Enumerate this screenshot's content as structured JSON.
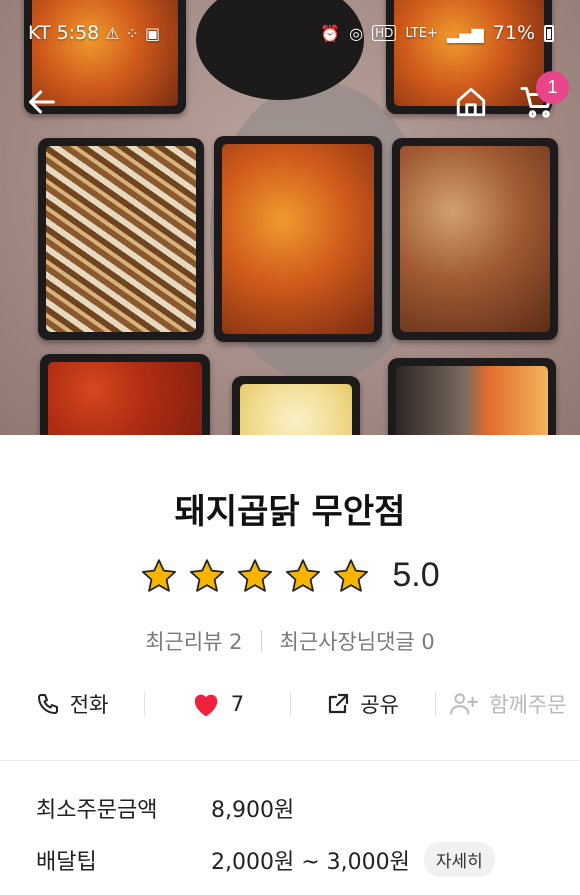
{
  "status_bar": {
    "carrier": "KT",
    "time": "5:58",
    "network": "LTE+",
    "battery": "71%"
  },
  "nav": {
    "cart_count": "1"
  },
  "store": {
    "name": "돼지곱닭 무안점",
    "rating": "5.0",
    "star_count": 5,
    "recent_reviews": "최근리뷰 2",
    "owner_comments": "최근사장님댓글 0"
  },
  "actions": {
    "call": "전화",
    "likes": "7",
    "share": "공유",
    "group_order": "함께주문"
  },
  "order_info": {
    "min_order_label": "최소주문금액",
    "min_order_value": "8,900원",
    "delivery_tip_label": "배달팁",
    "delivery_tip_value": "2,000원 ~ 3,000원",
    "detail_label": "자세히"
  },
  "colors": {
    "accent_badge": "#e9458b",
    "heart": "#f0213d",
    "star": "#f7b500"
  }
}
